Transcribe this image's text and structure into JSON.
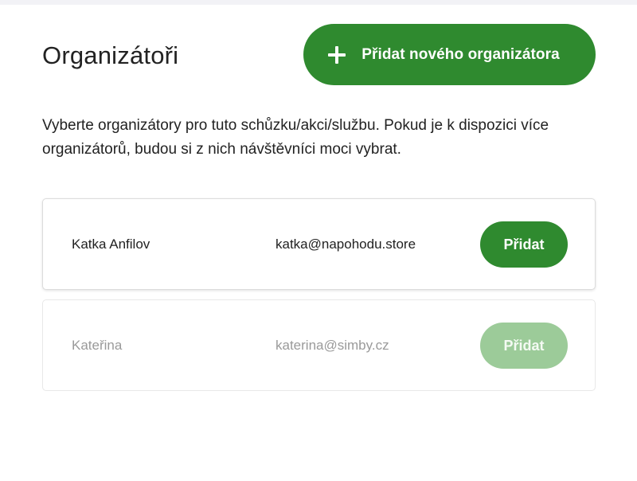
{
  "header": {
    "title": "Organizátoři",
    "add_new_label": "Přidat nového organizátora",
    "add_icon": "plus-icon"
  },
  "description": "Vyberte organizátory pro tuto schůzku/akci/službu. Pokud je k dispozici více organizátorů, budou si z nich návštěvníci moci vybrat.",
  "organizers": [
    {
      "name": "Katka Anfilov",
      "email": "katka@napohodu.store",
      "action_label": "Přidat",
      "enabled": true
    },
    {
      "name": "Kateřina",
      "email": "katerina@simby.cz",
      "action_label": "Přidat",
      "enabled": false
    }
  ],
  "colors": {
    "primary_green": "#2f8a2f",
    "disabled_green": "#9ccb99",
    "border": "#dcdcdc",
    "disabled_text": "#9a9a9a"
  }
}
